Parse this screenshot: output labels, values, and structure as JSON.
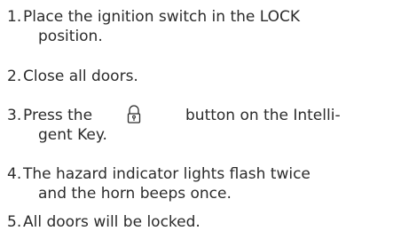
{
  "steps": [
    {
      "number": "1.",
      "line1": "Place the ignition switch in the LOCK",
      "line2": "position."
    },
    {
      "number": "2.",
      "line1": "Close all doors."
    },
    {
      "number": "3.",
      "before_icon": "Press the",
      "after_icon": "button on the Intelli-",
      "line2": "gent Key.",
      "icon": "lock-icon"
    },
    {
      "number": "4.",
      "line1": "The hazard indicator lights flash twice",
      "line2": "and the horn beeps once."
    },
    {
      "number": "5.",
      "line1": "All doors will be locked."
    }
  ]
}
